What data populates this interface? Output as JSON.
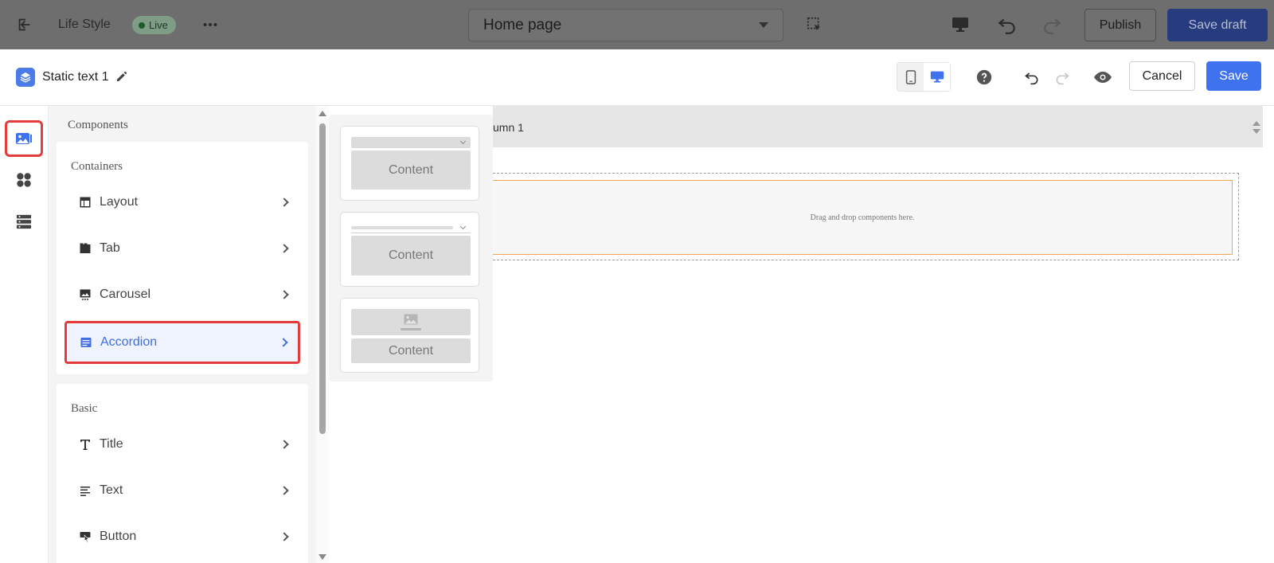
{
  "topbar": {
    "site_name": "Life Style",
    "status": "Live",
    "page_select": "Home page",
    "publish_label": "Publish",
    "save_draft_label": "Save draft"
  },
  "editor": {
    "title": "Static text 1",
    "cancel_label": "Cancel",
    "save_label": "Save",
    "accent_color": "#3f72ef"
  },
  "components": {
    "heading": "Components",
    "containers_title": "Containers",
    "containers": [
      {
        "label": "Layout",
        "icon": "layout-icon"
      },
      {
        "label": "Tab",
        "icon": "tab-icon"
      },
      {
        "label": "Carousel",
        "icon": "carousel-icon"
      },
      {
        "label": "Accordion",
        "icon": "accordion-icon",
        "selected": true
      }
    ],
    "basic_title": "Basic",
    "basic": [
      {
        "label": "Title",
        "icon": "title-icon"
      },
      {
        "label": "Text",
        "icon": "text-icon"
      },
      {
        "label": "Button",
        "icon": "button-icon"
      }
    ]
  },
  "templates": [
    {
      "content_label": "Content"
    },
    {
      "content_label": "Content"
    },
    {
      "content_label": "Content"
    }
  ],
  "canvas": {
    "column_label": "umn 1",
    "drop_hint": "Drag and drop components here."
  }
}
